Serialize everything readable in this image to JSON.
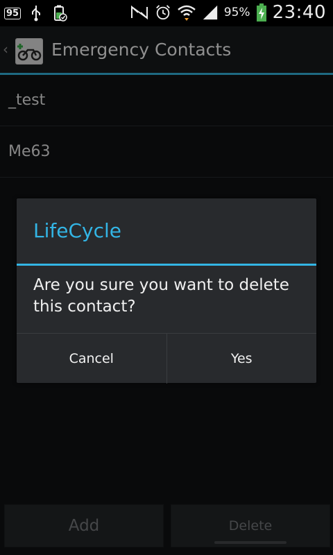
{
  "status_bar": {
    "notification_badge": "95",
    "battery_percent": "95%",
    "time": "23:40"
  },
  "action_bar": {
    "title": "Emergency Contacts"
  },
  "contacts": [
    {
      "name": "_test"
    },
    {
      "name": "Me63"
    }
  ],
  "dialog": {
    "title": "LifeCycle",
    "message": "Are you sure you want to delete this contact?",
    "cancel_label": "Cancel",
    "yes_label": "Yes"
  },
  "buttons": {
    "add_label": "Add",
    "delete_label": "Delete"
  },
  "colors": {
    "accent": "#33b5e5",
    "battery_green": "#4caf50"
  }
}
